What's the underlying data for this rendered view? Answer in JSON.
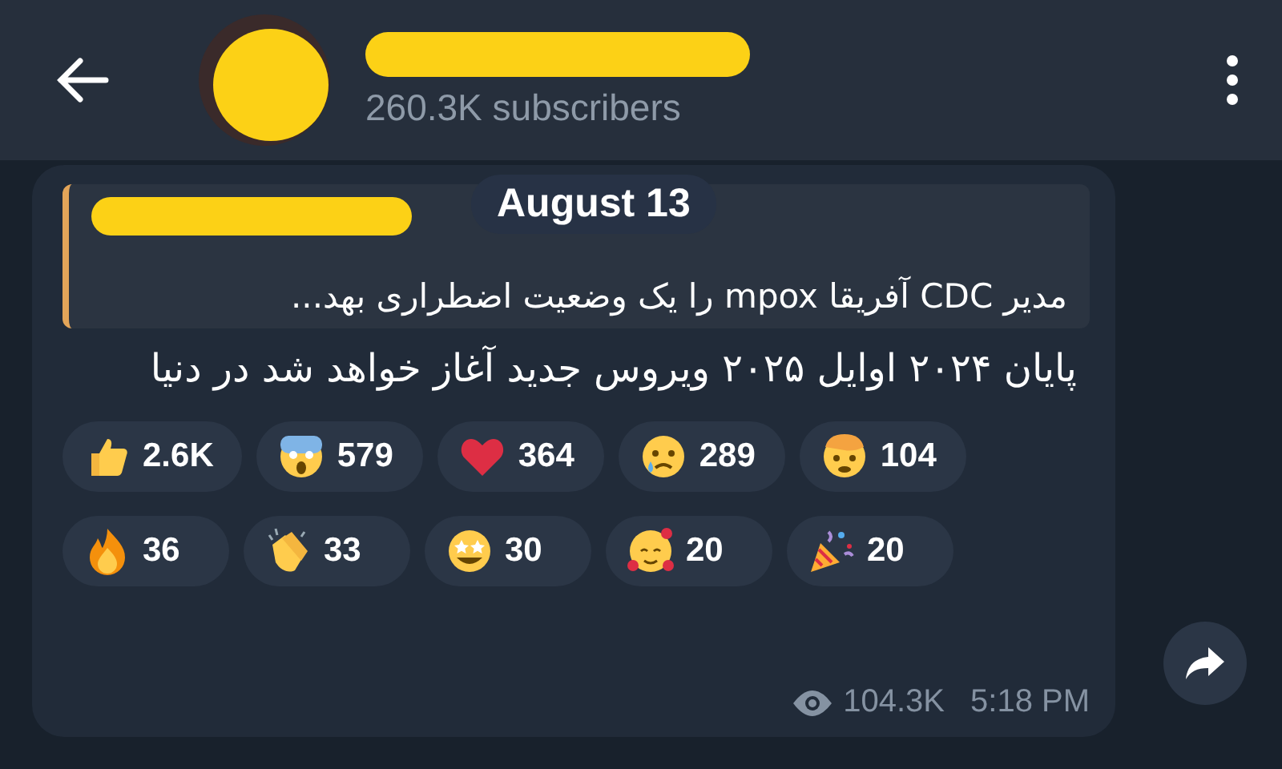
{
  "header": {
    "subtitle": "260.3K subscribers"
  },
  "date_pill": "August 13",
  "message": {
    "reply": {
      "text": "مدیر CDC آفریقا mpox را یک وضعیت اضطراری بهد..."
    },
    "text": "پایان ۲۰۲۴ اوایل ۲۰۲۵ ویروس جدید آغاز خواهد شد در دنیا",
    "reactions": [
      {
        "kind": "thumbs-up",
        "count": "2.6K"
      },
      {
        "kind": "scream",
        "count": "579"
      },
      {
        "kind": "heart",
        "count": "364"
      },
      {
        "kind": "cry",
        "count": "289"
      },
      {
        "kind": "exploding",
        "count": "104"
      },
      {
        "kind": "fire",
        "count": "36"
      },
      {
        "kind": "clap",
        "count": "33"
      },
      {
        "kind": "star-eyes",
        "count": "30"
      },
      {
        "kind": "hearts-face",
        "count": "20"
      },
      {
        "kind": "party",
        "count": "20"
      }
    ],
    "views": "104.3K",
    "time": "5:18 PM"
  }
}
